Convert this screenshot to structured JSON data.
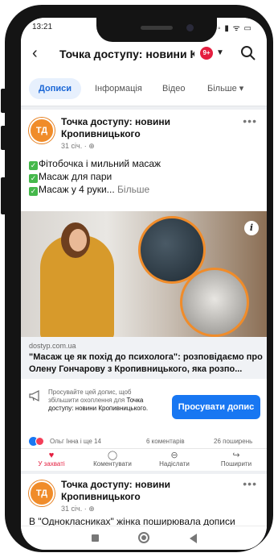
{
  "status": {
    "time": "13:21",
    "icons": "▲ ◦ ▮ ᯤ ▭"
  },
  "header": {
    "title": "Точка доступу: новини К...",
    "badge": "9+"
  },
  "tabs": [
    "Дописи",
    "Інформація",
    "Відео",
    "Більше ▾"
  ],
  "post1": {
    "avatar": "ТД",
    "page_name": "Точка доступу: новини Кропивницького",
    "meta": "31 січ. · ",
    "lines": [
      "Фітобочка і мильний масаж",
      "Масаж для пари",
      "Масаж у 4 руки..."
    ],
    "more": "Більше",
    "link": {
      "domain": "dostyp.com.ua",
      "title": "\"Масаж це як похід до психолога\": розповідаємо про Олену Гончарову з Кропивницького, яка розпо..."
    },
    "promo": {
      "text": "Просувайте цей допис, щоб збільшити охоплення для",
      "page": "Точка доступу: новини Кропивницького.",
      "button": "Просувати допис"
    },
    "reactions": {
      "names": "Ольг   Інна і ще 14",
      "comments": "6 коментарів",
      "shares": "26 поширень"
    },
    "actions": [
      {
        "label": "У захваті",
        "icon": "♥"
      },
      {
        "label": "Коментувати",
        "icon": "◯"
      },
      {
        "label": "Надіслати",
        "icon": "⊖"
      },
      {
        "label": "Поширити",
        "icon": "↪"
      }
    ]
  },
  "post2": {
    "avatar": "ТД",
    "page_name": "Точка доступу: новини Кропивницького",
    "meta": "31 січ. · ",
    "text": "В \"Однокласниках\" жінка поширювала дописи"
  },
  "colors": {
    "accent": "#1877f2",
    "brand_avatar": "#f08c2a",
    "like_red": "#e41e3f"
  }
}
